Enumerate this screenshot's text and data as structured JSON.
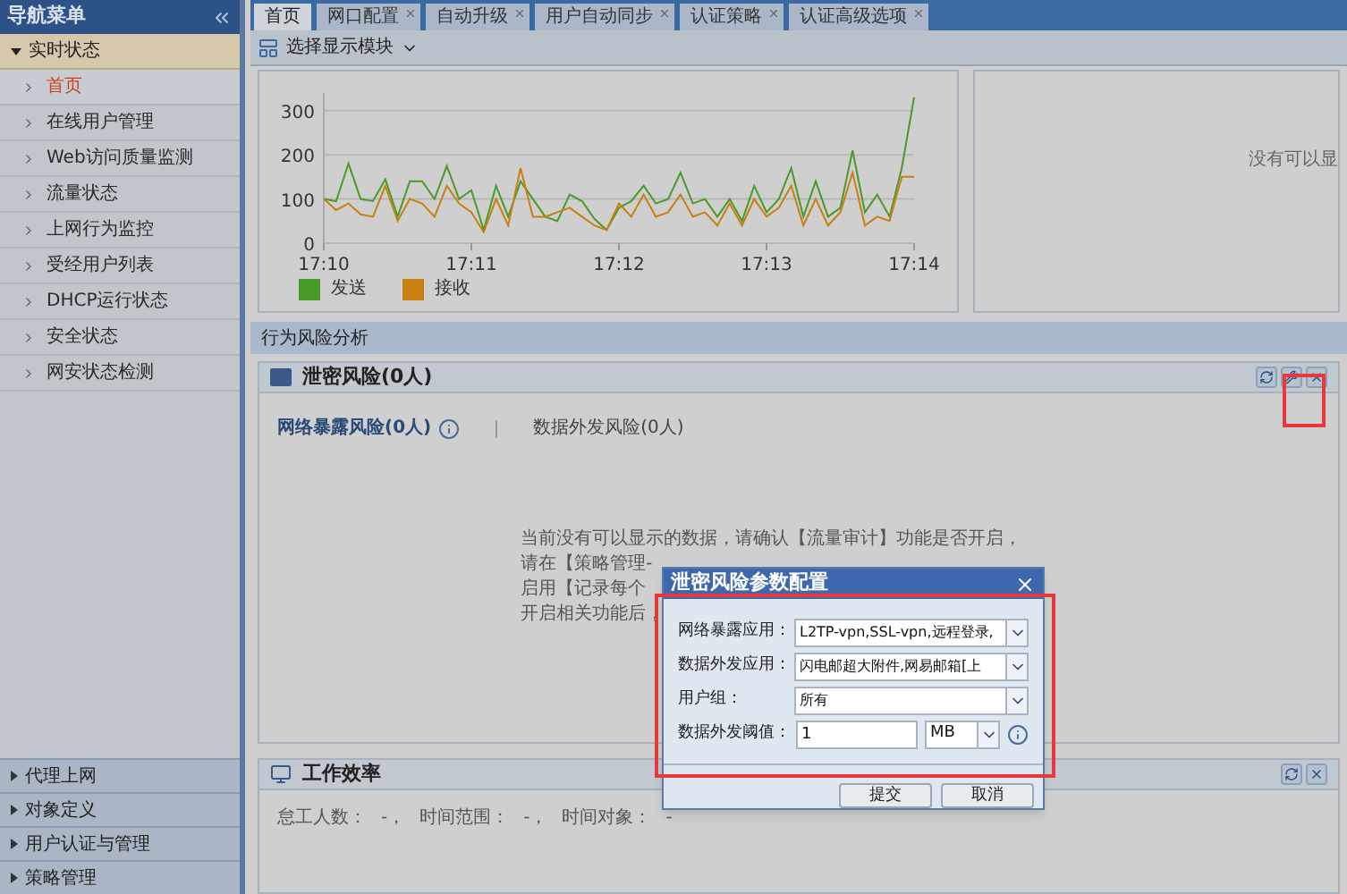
{
  "sidebar": {
    "title": "导航菜单",
    "groups": [
      {
        "label": "实时状态",
        "expanded": true,
        "items": [
          {
            "label": "首页",
            "selected": true
          },
          {
            "label": "在线用户管理",
            "selected": false
          },
          {
            "label": "Web访问质量监测",
            "selected": false
          },
          {
            "label": "流量状态",
            "selected": false
          },
          {
            "label": "上网行为监控",
            "selected": false
          },
          {
            "label": "受经用户列表",
            "selected": false
          },
          {
            "label": "DHCP运行状态",
            "selected": false
          },
          {
            "label": "安全状态",
            "selected": false
          },
          {
            "label": "网安状态检测",
            "selected": false
          }
        ]
      },
      {
        "label": "代理上网",
        "expanded": false
      },
      {
        "label": "对象定义",
        "expanded": false
      },
      {
        "label": "用户认证与管理",
        "expanded": false
      },
      {
        "label": "策略管理",
        "expanded": false
      }
    ]
  },
  "tabs": [
    {
      "label": "首页",
      "selected": true,
      "closable": false
    },
    {
      "label": "网口配置",
      "selected": false,
      "closable": true
    },
    {
      "label": "自动升级",
      "selected": false,
      "closable": true
    },
    {
      "label": "用户自动同步",
      "selected": false,
      "closable": true
    },
    {
      "label": "认证策略",
      "selected": false,
      "closable": true
    },
    {
      "label": "认证高级选项",
      "selected": false,
      "closable": true
    }
  ],
  "toolbar": {
    "module_button": "选择显示模块"
  },
  "traffic_panel": {
    "chart_data": {
      "type": "line",
      "categories": [
        "17:10",
        null,
        null,
        null,
        null,
        null,
        null,
        null,
        null,
        null,
        null,
        null,
        "17:11",
        null,
        null,
        null,
        null,
        null,
        null,
        null,
        null,
        null,
        null,
        null,
        "17:12",
        null,
        null,
        null,
        null,
        null,
        null,
        null,
        null,
        null,
        null,
        null,
        "17:13",
        null,
        null,
        null,
        null,
        null,
        null,
        null,
        null,
        null,
        null,
        null,
        "17:14"
      ],
      "ylim": [
        0,
        340
      ],
      "yticks": [
        0,
        100,
        200,
        300
      ],
      "grid": true,
      "legend": "bottom",
      "series": [
        {
          "name": "发送",
          "color": "#4a9a2a",
          "values": [
            100,
            95,
            180,
            100,
            95,
            145,
            60,
            140,
            140,
            100,
            175,
            100,
            120,
            30,
            130,
            60,
            140,
            100,
            60,
            50,
            110,
            95,
            55,
            30,
            80,
            95,
            130,
            90,
            100,
            160,
            90,
            100,
            60,
            100,
            50,
            130,
            70,
            100,
            170,
            60,
            140,
            60,
            80,
            210,
            70,
            110,
            60,
            170,
            330
          ]
        },
        {
          "name": "接收",
          "color": "#c88010",
          "values": [
            100,
            75,
            90,
            65,
            60,
            130,
            50,
            100,
            90,
            60,
            130,
            90,
            70,
            25,
            100,
            40,
            170,
            60,
            60,
            70,
            80,
            60,
            40,
            30,
            90,
            60,
            110,
            60,
            70,
            110,
            60,
            70,
            40,
            90,
            40,
            100,
            60,
            80,
            130,
            40,
            100,
            40,
            70,
            160,
            40,
            60,
            50,
            150,
            150
          ]
        }
      ]
    }
  },
  "side_panel": {
    "message": "没有可以显"
  },
  "section": {
    "title": "行为风险分析"
  },
  "risk_panel": {
    "title": "泄密风险(0人)",
    "subtabs": [
      {
        "label": "网络暴露风险(0人)",
        "selected": true
      },
      {
        "label": "数据外发风险(0人)",
        "selected": false
      }
    ],
    "message_lines": [
      "当前没有可以显示的数据，请确认【流量审计】功能是否开启，",
      "请在【策略管理-",
      "启用【记录每个",
      "开启相关功能后，"
    ]
  },
  "work_panel": {
    "title": "工作效率",
    "fields": [
      {
        "label": "怠工人数：",
        "value": "-，"
      },
      {
        "label": "时间范围：",
        "value": "-，"
      },
      {
        "label": "时间对象：",
        "value": "-"
      }
    ]
  },
  "dialog": {
    "title": "泄密风险参数配置",
    "rows": [
      {
        "kind": "select",
        "label": "网络暴露应用：",
        "value": "L2TP-vpn,SSL-vpn,远程登录,"
      },
      {
        "kind": "select",
        "label": "数据外发应用：",
        "value": "闪电邮超大附件,网易邮箱[上"
      },
      {
        "kind": "select",
        "label": "用户组：",
        "value": "所有"
      },
      {
        "kind": "threshold",
        "label": "数据外发阈值：",
        "value": "1",
        "unit": "MB"
      }
    ],
    "buttons": [
      "提交",
      "取消"
    ]
  }
}
